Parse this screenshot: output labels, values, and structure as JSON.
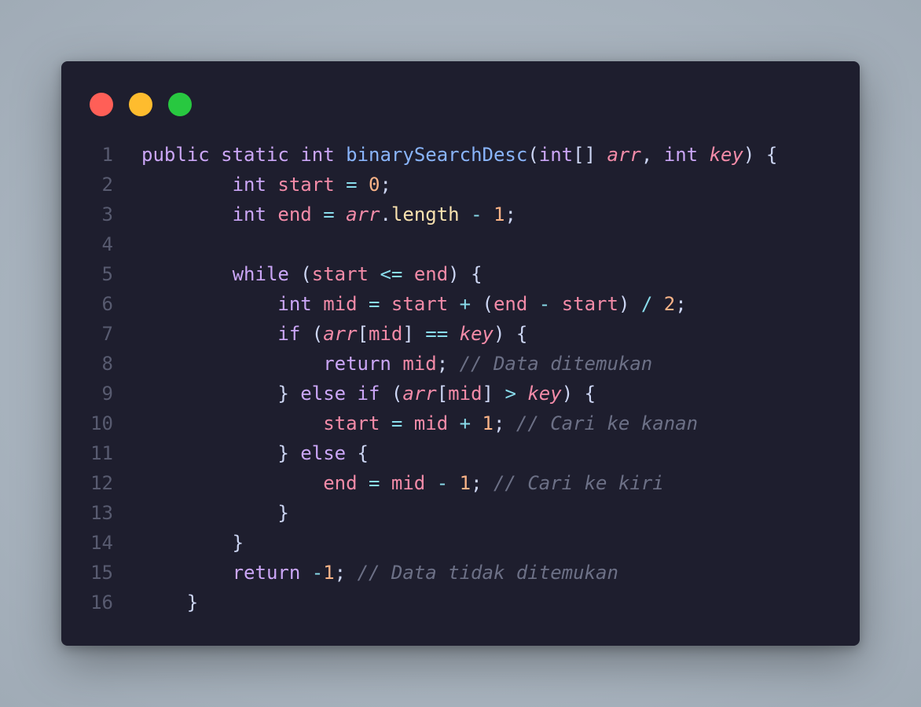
{
  "window": {
    "controls": {
      "close_color": "#ff5f57",
      "minimize_color": "#febc2e",
      "maximize_color": "#28c840"
    }
  },
  "code": {
    "language": "java",
    "lines": [
      {
        "n": "1",
        "indent": "",
        "tokens": [
          {
            "t": "kw",
            "v": "public"
          },
          {
            "t": "pun",
            "v": " "
          },
          {
            "t": "kw",
            "v": "static"
          },
          {
            "t": "pun",
            "v": " "
          },
          {
            "t": "kw",
            "v": "int"
          },
          {
            "t": "pun",
            "v": " "
          },
          {
            "t": "fn",
            "v": "binarySearchDesc"
          },
          {
            "t": "pun",
            "v": "("
          },
          {
            "t": "kw",
            "v": "int"
          },
          {
            "t": "pun",
            "v": "[] "
          },
          {
            "t": "param",
            "v": "arr"
          },
          {
            "t": "pun",
            "v": ", "
          },
          {
            "t": "kw",
            "v": "int"
          },
          {
            "t": "pun",
            "v": " "
          },
          {
            "t": "param",
            "v": "key"
          },
          {
            "t": "pun",
            "v": ") {"
          }
        ]
      },
      {
        "n": "2",
        "indent": "        ",
        "tokens": [
          {
            "t": "kw",
            "v": "int"
          },
          {
            "t": "pun",
            "v": " "
          },
          {
            "t": "var",
            "v": "start"
          },
          {
            "t": "pun",
            "v": " "
          },
          {
            "t": "op",
            "v": "="
          },
          {
            "t": "pun",
            "v": " "
          },
          {
            "t": "num",
            "v": "0"
          },
          {
            "t": "pun",
            "v": ";"
          }
        ]
      },
      {
        "n": "3",
        "indent": "        ",
        "tokens": [
          {
            "t": "kw",
            "v": "int"
          },
          {
            "t": "pun",
            "v": " "
          },
          {
            "t": "var",
            "v": "end"
          },
          {
            "t": "pun",
            "v": " "
          },
          {
            "t": "op",
            "v": "="
          },
          {
            "t": "pun",
            "v": " "
          },
          {
            "t": "param",
            "v": "arr"
          },
          {
            "t": "pun",
            "v": "."
          },
          {
            "t": "prop",
            "v": "length"
          },
          {
            "t": "pun",
            "v": " "
          },
          {
            "t": "op",
            "v": "-"
          },
          {
            "t": "pun",
            "v": " "
          },
          {
            "t": "num",
            "v": "1"
          },
          {
            "t": "pun",
            "v": ";"
          }
        ]
      },
      {
        "n": "4",
        "indent": "",
        "tokens": []
      },
      {
        "n": "5",
        "indent": "        ",
        "tokens": [
          {
            "t": "kw",
            "v": "while"
          },
          {
            "t": "pun",
            "v": " ("
          },
          {
            "t": "var",
            "v": "start"
          },
          {
            "t": "pun",
            "v": " "
          },
          {
            "t": "op",
            "v": "<="
          },
          {
            "t": "pun",
            "v": " "
          },
          {
            "t": "var",
            "v": "end"
          },
          {
            "t": "pun",
            "v": ") {"
          }
        ]
      },
      {
        "n": "6",
        "indent": "            ",
        "tokens": [
          {
            "t": "kw",
            "v": "int"
          },
          {
            "t": "pun",
            "v": " "
          },
          {
            "t": "var",
            "v": "mid"
          },
          {
            "t": "pun",
            "v": " "
          },
          {
            "t": "op",
            "v": "="
          },
          {
            "t": "pun",
            "v": " "
          },
          {
            "t": "var",
            "v": "start"
          },
          {
            "t": "pun",
            "v": " "
          },
          {
            "t": "op",
            "v": "+"
          },
          {
            "t": "pun",
            "v": " ("
          },
          {
            "t": "var",
            "v": "end"
          },
          {
            "t": "pun",
            "v": " "
          },
          {
            "t": "op",
            "v": "-"
          },
          {
            "t": "pun",
            "v": " "
          },
          {
            "t": "var",
            "v": "start"
          },
          {
            "t": "pun",
            "v": ") "
          },
          {
            "t": "op",
            "v": "/"
          },
          {
            "t": "pun",
            "v": " "
          },
          {
            "t": "num",
            "v": "2"
          },
          {
            "t": "pun",
            "v": ";"
          }
        ]
      },
      {
        "n": "7",
        "indent": "            ",
        "tokens": [
          {
            "t": "kw",
            "v": "if"
          },
          {
            "t": "pun",
            "v": " ("
          },
          {
            "t": "param",
            "v": "arr"
          },
          {
            "t": "pun",
            "v": "["
          },
          {
            "t": "var",
            "v": "mid"
          },
          {
            "t": "pun",
            "v": "] "
          },
          {
            "t": "op",
            "v": "=="
          },
          {
            "t": "pun",
            "v": " "
          },
          {
            "t": "param",
            "v": "key"
          },
          {
            "t": "pun",
            "v": ") {"
          }
        ]
      },
      {
        "n": "8",
        "indent": "                ",
        "tokens": [
          {
            "t": "kw",
            "v": "return"
          },
          {
            "t": "pun",
            "v": " "
          },
          {
            "t": "var",
            "v": "mid"
          },
          {
            "t": "pun",
            "v": "; "
          },
          {
            "t": "cm",
            "v": "// Data ditemukan"
          }
        ]
      },
      {
        "n": "9",
        "indent": "            ",
        "tokens": [
          {
            "t": "pun",
            "v": "} "
          },
          {
            "t": "kw",
            "v": "else"
          },
          {
            "t": "pun",
            "v": " "
          },
          {
            "t": "kw",
            "v": "if"
          },
          {
            "t": "pun",
            "v": " ("
          },
          {
            "t": "param",
            "v": "arr"
          },
          {
            "t": "pun",
            "v": "["
          },
          {
            "t": "var",
            "v": "mid"
          },
          {
            "t": "pun",
            "v": "] "
          },
          {
            "t": "op",
            "v": ">"
          },
          {
            "t": "pun",
            "v": " "
          },
          {
            "t": "param",
            "v": "key"
          },
          {
            "t": "pun",
            "v": ") {"
          }
        ]
      },
      {
        "n": "10",
        "indent": "                ",
        "tokens": [
          {
            "t": "var",
            "v": "start"
          },
          {
            "t": "pun",
            "v": " "
          },
          {
            "t": "op",
            "v": "="
          },
          {
            "t": "pun",
            "v": " "
          },
          {
            "t": "var",
            "v": "mid"
          },
          {
            "t": "pun",
            "v": " "
          },
          {
            "t": "op",
            "v": "+"
          },
          {
            "t": "pun",
            "v": " "
          },
          {
            "t": "num",
            "v": "1"
          },
          {
            "t": "pun",
            "v": "; "
          },
          {
            "t": "cm",
            "v": "// Cari ke kanan"
          }
        ]
      },
      {
        "n": "11",
        "indent": "            ",
        "tokens": [
          {
            "t": "pun",
            "v": "} "
          },
          {
            "t": "kw",
            "v": "else"
          },
          {
            "t": "pun",
            "v": " {"
          }
        ]
      },
      {
        "n": "12",
        "indent": "                ",
        "tokens": [
          {
            "t": "var",
            "v": "end"
          },
          {
            "t": "pun",
            "v": " "
          },
          {
            "t": "op",
            "v": "="
          },
          {
            "t": "pun",
            "v": " "
          },
          {
            "t": "var",
            "v": "mid"
          },
          {
            "t": "pun",
            "v": " "
          },
          {
            "t": "op",
            "v": "-"
          },
          {
            "t": "pun",
            "v": " "
          },
          {
            "t": "num",
            "v": "1"
          },
          {
            "t": "pun",
            "v": "; "
          },
          {
            "t": "cm",
            "v": "// Cari ke kiri"
          }
        ]
      },
      {
        "n": "13",
        "indent": "            ",
        "tokens": [
          {
            "t": "pun",
            "v": "}"
          }
        ]
      },
      {
        "n": "14",
        "indent": "        ",
        "tokens": [
          {
            "t": "pun",
            "v": "}"
          }
        ]
      },
      {
        "n": "15",
        "indent": "        ",
        "tokens": [
          {
            "t": "kw",
            "v": "return"
          },
          {
            "t": "pun",
            "v": " "
          },
          {
            "t": "op",
            "v": "-"
          },
          {
            "t": "num",
            "v": "1"
          },
          {
            "t": "pun",
            "v": "; "
          },
          {
            "t": "cm",
            "v": "// Data tidak ditemukan"
          }
        ]
      },
      {
        "n": "16",
        "indent": "    ",
        "tokens": [
          {
            "t": "pun",
            "v": "}"
          }
        ]
      }
    ]
  }
}
